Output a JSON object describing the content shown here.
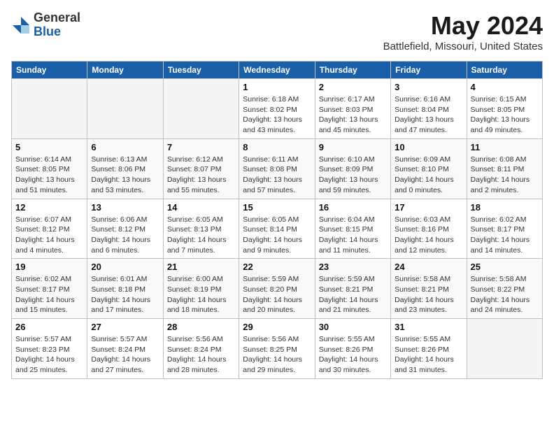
{
  "header": {
    "logo": {
      "general": "General",
      "blue": "Blue"
    },
    "title": "May 2024",
    "location": "Battlefield, Missouri, United States"
  },
  "weekdays": [
    "Sunday",
    "Monday",
    "Tuesday",
    "Wednesday",
    "Thursday",
    "Friday",
    "Saturday"
  ],
  "weeks": [
    [
      {
        "day": "",
        "info": ""
      },
      {
        "day": "",
        "info": ""
      },
      {
        "day": "",
        "info": ""
      },
      {
        "day": "1",
        "info": "Sunrise: 6:18 AM\nSunset: 8:02 PM\nDaylight: 13 hours\nand 43 minutes."
      },
      {
        "day": "2",
        "info": "Sunrise: 6:17 AM\nSunset: 8:03 PM\nDaylight: 13 hours\nand 45 minutes."
      },
      {
        "day": "3",
        "info": "Sunrise: 6:16 AM\nSunset: 8:04 PM\nDaylight: 13 hours\nand 47 minutes."
      },
      {
        "day": "4",
        "info": "Sunrise: 6:15 AM\nSunset: 8:05 PM\nDaylight: 13 hours\nand 49 minutes."
      }
    ],
    [
      {
        "day": "5",
        "info": "Sunrise: 6:14 AM\nSunset: 8:05 PM\nDaylight: 13 hours\nand 51 minutes."
      },
      {
        "day": "6",
        "info": "Sunrise: 6:13 AM\nSunset: 8:06 PM\nDaylight: 13 hours\nand 53 minutes."
      },
      {
        "day": "7",
        "info": "Sunrise: 6:12 AM\nSunset: 8:07 PM\nDaylight: 13 hours\nand 55 minutes."
      },
      {
        "day": "8",
        "info": "Sunrise: 6:11 AM\nSunset: 8:08 PM\nDaylight: 13 hours\nand 57 minutes."
      },
      {
        "day": "9",
        "info": "Sunrise: 6:10 AM\nSunset: 8:09 PM\nDaylight: 13 hours\nand 59 minutes."
      },
      {
        "day": "10",
        "info": "Sunrise: 6:09 AM\nSunset: 8:10 PM\nDaylight: 14 hours\nand 0 minutes."
      },
      {
        "day": "11",
        "info": "Sunrise: 6:08 AM\nSunset: 8:11 PM\nDaylight: 14 hours\nand 2 minutes."
      }
    ],
    [
      {
        "day": "12",
        "info": "Sunrise: 6:07 AM\nSunset: 8:12 PM\nDaylight: 14 hours\nand 4 minutes."
      },
      {
        "day": "13",
        "info": "Sunrise: 6:06 AM\nSunset: 8:12 PM\nDaylight: 14 hours\nand 6 minutes."
      },
      {
        "day": "14",
        "info": "Sunrise: 6:05 AM\nSunset: 8:13 PM\nDaylight: 14 hours\nand 7 minutes."
      },
      {
        "day": "15",
        "info": "Sunrise: 6:05 AM\nSunset: 8:14 PM\nDaylight: 14 hours\nand 9 minutes."
      },
      {
        "day": "16",
        "info": "Sunrise: 6:04 AM\nSunset: 8:15 PM\nDaylight: 14 hours\nand 11 minutes."
      },
      {
        "day": "17",
        "info": "Sunrise: 6:03 AM\nSunset: 8:16 PM\nDaylight: 14 hours\nand 12 minutes."
      },
      {
        "day": "18",
        "info": "Sunrise: 6:02 AM\nSunset: 8:17 PM\nDaylight: 14 hours\nand 14 minutes."
      }
    ],
    [
      {
        "day": "19",
        "info": "Sunrise: 6:02 AM\nSunset: 8:17 PM\nDaylight: 14 hours\nand 15 minutes."
      },
      {
        "day": "20",
        "info": "Sunrise: 6:01 AM\nSunset: 8:18 PM\nDaylight: 14 hours\nand 17 minutes."
      },
      {
        "day": "21",
        "info": "Sunrise: 6:00 AM\nSunset: 8:19 PM\nDaylight: 14 hours\nand 18 minutes."
      },
      {
        "day": "22",
        "info": "Sunrise: 5:59 AM\nSunset: 8:20 PM\nDaylight: 14 hours\nand 20 minutes."
      },
      {
        "day": "23",
        "info": "Sunrise: 5:59 AM\nSunset: 8:21 PM\nDaylight: 14 hours\nand 21 minutes."
      },
      {
        "day": "24",
        "info": "Sunrise: 5:58 AM\nSunset: 8:21 PM\nDaylight: 14 hours\nand 23 minutes."
      },
      {
        "day": "25",
        "info": "Sunrise: 5:58 AM\nSunset: 8:22 PM\nDaylight: 14 hours\nand 24 minutes."
      }
    ],
    [
      {
        "day": "26",
        "info": "Sunrise: 5:57 AM\nSunset: 8:23 PM\nDaylight: 14 hours\nand 25 minutes."
      },
      {
        "day": "27",
        "info": "Sunrise: 5:57 AM\nSunset: 8:24 PM\nDaylight: 14 hours\nand 27 minutes."
      },
      {
        "day": "28",
        "info": "Sunrise: 5:56 AM\nSunset: 8:24 PM\nDaylight: 14 hours\nand 28 minutes."
      },
      {
        "day": "29",
        "info": "Sunrise: 5:56 AM\nSunset: 8:25 PM\nDaylight: 14 hours\nand 29 minutes."
      },
      {
        "day": "30",
        "info": "Sunrise: 5:55 AM\nSunset: 8:26 PM\nDaylight: 14 hours\nand 30 minutes."
      },
      {
        "day": "31",
        "info": "Sunrise: 5:55 AM\nSunset: 8:26 PM\nDaylight: 14 hours\nand 31 minutes."
      },
      {
        "day": "",
        "info": ""
      }
    ]
  ]
}
